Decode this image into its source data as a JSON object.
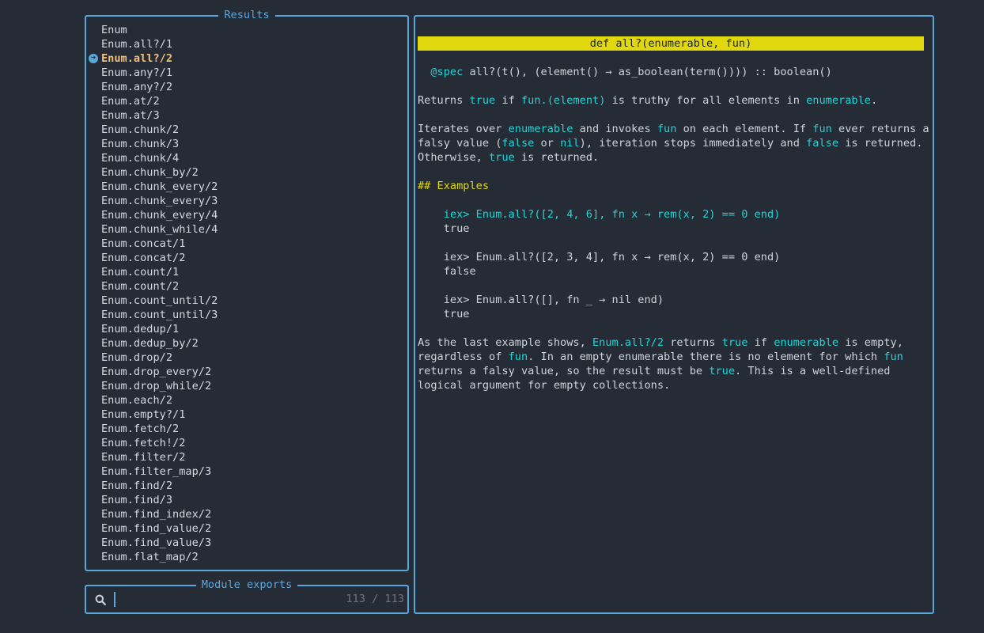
{
  "results": {
    "title": "Results",
    "selected_index": 2,
    "items": [
      "Enum",
      "Enum.all?/1",
      "Enum.all?/2",
      "Enum.any?/1",
      "Enum.any?/2",
      "Enum.at/2",
      "Enum.at/3",
      "Enum.chunk/2",
      "Enum.chunk/3",
      "Enum.chunk/4",
      "Enum.chunk_by/2",
      "Enum.chunk_every/2",
      "Enum.chunk_every/3",
      "Enum.chunk_every/4",
      "Enum.chunk_while/4",
      "Enum.concat/1",
      "Enum.concat/2",
      "Enum.count/1",
      "Enum.count/2",
      "Enum.count_until/2",
      "Enum.count_until/3",
      "Enum.dedup/1",
      "Enum.dedup_by/2",
      "Enum.drop/2",
      "Enum.drop_every/2",
      "Enum.drop_while/2",
      "Enum.each/2",
      "Enum.empty?/1",
      "Enum.fetch/2",
      "Enum.fetch!/2",
      "Enum.filter/2",
      "Enum.filter_map/3",
      "Enum.find/2",
      "Enum.find/3",
      "Enum.find_index/2",
      "Enum.find_value/2",
      "Enum.find_value/3",
      "Enum.flat_map/2"
    ]
  },
  "search": {
    "title": "Module exports",
    "value": "",
    "placeholder": "",
    "count": "113 / 113",
    "icon": "search-icon"
  },
  "doc": {
    "signature": "def all?(enumerable, fun)",
    "lines": [
      {
        "type": "blank"
      },
      {
        "type": "spans",
        "spans": [
          {
            "t": "  "
          },
          {
            "t": "@spec",
            "c": "hl"
          },
          {
            "t": " all?(t(), (element() → as_boolean(term()))) :: boolean()"
          }
        ]
      },
      {
        "type": "blank"
      },
      {
        "type": "spans",
        "spans": [
          {
            "t": "Returns "
          },
          {
            "t": "true",
            "c": "hl"
          },
          {
            "t": " if "
          },
          {
            "t": "fun.(element)",
            "c": "hl"
          },
          {
            "t": " is truthy for all elements in "
          },
          {
            "t": "enumerable",
            "c": "hl"
          },
          {
            "t": "."
          }
        ]
      },
      {
        "type": "blank"
      },
      {
        "type": "spans",
        "spans": [
          {
            "t": "Iterates over "
          },
          {
            "t": "enumerable",
            "c": "hl"
          },
          {
            "t": " and invokes "
          },
          {
            "t": "fun",
            "c": "hl"
          },
          {
            "t": " on each element. If "
          },
          {
            "t": "fun",
            "c": "hl"
          },
          {
            "t": " ever returns a"
          }
        ]
      },
      {
        "type": "spans",
        "spans": [
          {
            "t": "falsy value ("
          },
          {
            "t": "false",
            "c": "hl"
          },
          {
            "t": " or "
          },
          {
            "t": "nil",
            "c": "hl"
          },
          {
            "t": "), iteration stops immediately and "
          },
          {
            "t": "false",
            "c": "hl"
          },
          {
            "t": " is returned."
          }
        ]
      },
      {
        "type": "spans",
        "spans": [
          {
            "t": "Otherwise, "
          },
          {
            "t": "true",
            "c": "hl"
          },
          {
            "t": " is returned."
          }
        ]
      },
      {
        "type": "blank"
      },
      {
        "type": "spans",
        "spans": [
          {
            "t": "## Examples",
            "c": "head"
          }
        ]
      },
      {
        "type": "blank"
      },
      {
        "type": "spans",
        "spans": [
          {
            "t": "    "
          },
          {
            "t": "iex> Enum.all?([2, 4, 6], fn x → rem(x, 2) == 0 end)",
            "c": "hl"
          }
        ]
      },
      {
        "type": "spans",
        "spans": [
          {
            "t": "    true"
          }
        ]
      },
      {
        "type": "blank"
      },
      {
        "type": "spans",
        "spans": [
          {
            "t": "    iex> Enum.all?([2, 3, 4], fn x → rem(x, 2) == 0 end)"
          }
        ]
      },
      {
        "type": "spans",
        "spans": [
          {
            "t": "    false"
          }
        ]
      },
      {
        "type": "blank"
      },
      {
        "type": "spans",
        "spans": [
          {
            "t": "    iex> Enum.all?([], fn _ → nil end)"
          }
        ]
      },
      {
        "type": "spans",
        "spans": [
          {
            "t": "    true"
          }
        ]
      },
      {
        "type": "blank"
      },
      {
        "type": "spans",
        "spans": [
          {
            "t": "As the last example shows, "
          },
          {
            "t": "Enum.all?/2",
            "c": "hl"
          },
          {
            "t": " returns "
          },
          {
            "t": "true",
            "c": "hl"
          },
          {
            "t": " if "
          },
          {
            "t": "enumerable",
            "c": "hl"
          },
          {
            "t": " is empty,"
          }
        ]
      },
      {
        "type": "spans",
        "spans": [
          {
            "t": "regardless of "
          },
          {
            "t": "fun",
            "c": "hl"
          },
          {
            "t": ". In an empty enumerable there is no element for which "
          },
          {
            "t": "fun",
            "c": "hl"
          }
        ]
      },
      {
        "type": "spans",
        "spans": [
          {
            "t": "returns a falsy value, so the result must be "
          },
          {
            "t": "true",
            "c": "hl"
          },
          {
            "t": ". This is a well-defined"
          }
        ]
      },
      {
        "type": "spans",
        "spans": [
          {
            "t": "logical argument for empty collections."
          }
        ]
      }
    ]
  },
  "colors": {
    "background": "#262c36",
    "border": "#5aa7dc",
    "selected": "#f4c07a",
    "highlight": "#22d3d6",
    "signature_bar": "#e0d80c"
  }
}
